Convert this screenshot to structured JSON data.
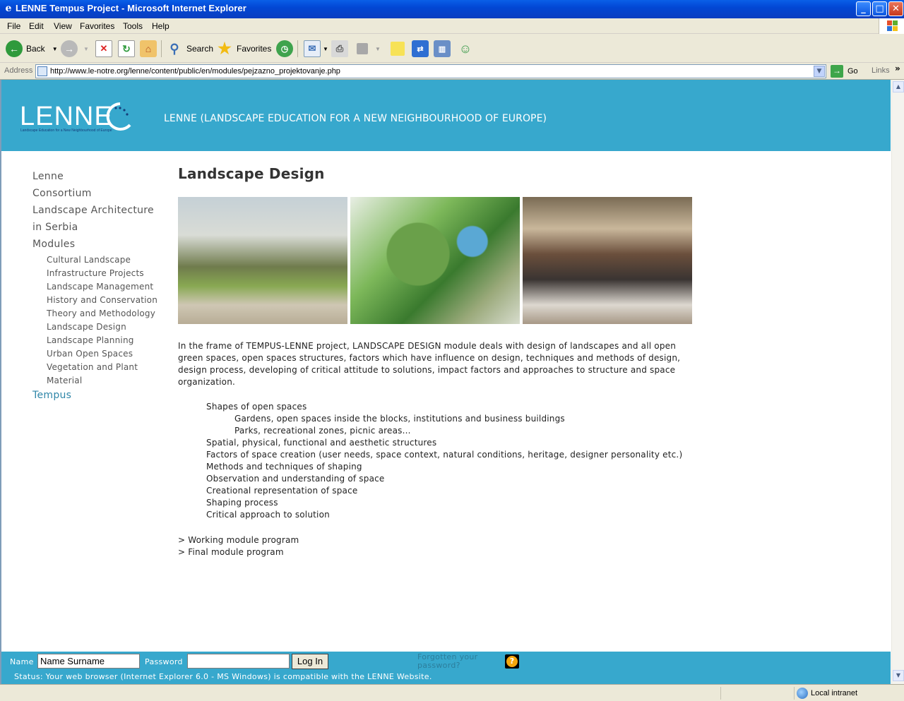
{
  "window": {
    "title": "LENNE Tempus Project - Microsoft Internet Explorer",
    "min_glyph": "_",
    "max_glyph": "□",
    "close_glyph": "✕"
  },
  "menu": [
    "File",
    "Edit",
    "View",
    "Favorites",
    "Tools",
    "Help"
  ],
  "toolbar": {
    "back": "Back",
    "search": "Search",
    "favorites": "Favorites"
  },
  "address": {
    "label": "Address",
    "url": "http://www.le-notre.org/lenne/content/public/en/modules/pejzazno_projektovanje.php",
    "go": "Go",
    "links": "Links"
  },
  "site": {
    "logo_text": "LENNE",
    "logo_tagline": "Landscape Education for a New Neighbourhood of Europe",
    "banner_title": "LENNE (LANDSCAPE EDUCATION FOR A NEW NEIGHBOURHOOD OF EUROPE)",
    "accent": "#37a8cd"
  },
  "nav": {
    "top": [
      "Lenne",
      "Consortium",
      "Landscape Architecture",
      "in Serbia",
      "Modules"
    ],
    "modules": [
      "Cultural Landscape",
      "Infrastructure Projects",
      "Landscape Management",
      "History and Conservation",
      "Theory and Methodology",
      "Landscape Design",
      "Landscape Planning",
      "Urban Open Spaces",
      "Vegetation and Plant",
      "Material"
    ],
    "tempus": "Tempus"
  },
  "content": {
    "title": "Landscape Design",
    "intro": "In the frame of TEMPUS-LENNE project, LANDSCAPE DESIGN module deals with design of landscapes and all open green spaces, open spaces structures, factors which have influence on design, techniques and methods of design, design process, developing of critical attitude to solutions, impact factors and approaches to structure and space organization.",
    "list": {
      "shapes": "Shapes of open spaces",
      "gardens": "Gardens, open spaces inside the blocks, institutions and business buildings",
      "parks": "Parks, recreational zones, picnic areas...",
      "spatial": "Spatial, physical, functional and aesthetic structures",
      "factors": "Factors of space creation (user needs, space context, natural conditions, heritage, designer personality etc.)",
      "methods": "Methods and techniques of shaping",
      "observation": "Observation and understanding of space",
      "creational": "Creational representation of space",
      "shaping": "Shaping process",
      "critical": "Critical approach to solution"
    },
    "links": {
      "working": "> Working module program",
      "final": "> Final module program"
    }
  },
  "footer": {
    "name_label": "Name",
    "name_value": "Name Surname",
    "password_label": "Password",
    "login": "Log In",
    "forgotten": "Forgotten your password?",
    "help_glyph": "?",
    "status": "Status: Your web browser (Internet Explorer 6.0 - MS Windows) is compatible with the LENNE Website."
  },
  "statusbar": {
    "zone": "Local intranet"
  }
}
